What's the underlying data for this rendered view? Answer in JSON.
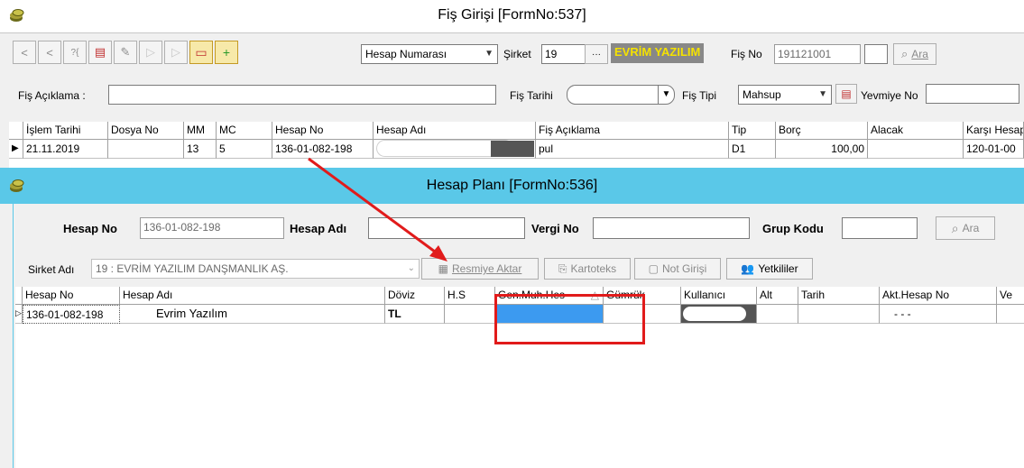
{
  "window1": {
    "title": "Fiş Girişi [FormNo:537]",
    "search_field_select": "Hesap Numarası",
    "sirket_label": "Şirket",
    "sirket_value": "19",
    "sirket_ellipsis": "···",
    "company_name": "EVRİM YAZILIM",
    "fis_no_label": "Fiş No",
    "fis_no_value": "191121001",
    "ara_label": "Ara",
    "fis_aciklama_label": "Fiş Açıklama :",
    "fis_aciklama_value": "",
    "fis_tarihi_label": "Fiş Tarihi",
    "fis_tipi_label": "Fiş  Tipi",
    "fis_tipi_value": "Mahsup",
    "yevmiye_no_label": "Yevmiye No",
    "yevmiye_no_value": "",
    "grid": {
      "columns": [
        "İşlem Tarihi",
        "Dosya No",
        "MM",
        "MC",
        "Hesap No",
        "Hesap Adı",
        "Fiş Açıklama",
        "Tip",
        "Borç",
        "Alacak",
        "Karşı Hesap"
      ],
      "row": {
        "islem_tarihi": "21.11.2019",
        "dosya_no": "",
        "mm": "13",
        "mc": "5",
        "hesap_no": "136-01-082-198",
        "fis_aciklama": "pul",
        "tip": "D1",
        "borc": "100,00",
        "alacak": "",
        "karsi_hesap": "120-01-00"
      }
    }
  },
  "window2": {
    "title": "Hesap Planı [FormNo:536]",
    "hesap_no_label": "Hesap No",
    "hesap_no_value": "136-01-082-198",
    "hesap_adi_label": "Hesap Adı",
    "vergi_no_label": "Vergi No",
    "grup_kodu_label": "Grup Kodu",
    "ara_label": "Ara",
    "sirket_adi_label": "Sirket Adı",
    "sirket_adi_value": "19 : EVRİM YAZILIM DANŞMANLIK AŞ.",
    "resmiye_aktar": "Resmiye Aktar",
    "kartoteks": "Kartoteks",
    "not_girisi": "Not Girişi",
    "yetkililer": "Yetkililer",
    "grid": {
      "columns": [
        "Hesap No",
        "Hesap Adı",
        "Döviz",
        "H.S",
        "Gen.Muh.Hes",
        "Gümrük",
        "Kullanıcı",
        "Alt",
        "Tarih",
        "Akt.Hesap No",
        "Ve"
      ],
      "sort_indicator": "△",
      "row": {
        "hesap_no": "136-01-082-198",
        "hesap_adi": "Evrim Yazılım",
        "doviz": "TL",
        "akt_hesap_no": "- - -"
      }
    }
  },
  "colors": {
    "annotation": "#e11b1b",
    "titlebar2": "#5ac8e8",
    "selected_cell": "#3c9af0",
    "company_badge_text": "#f5e200"
  }
}
